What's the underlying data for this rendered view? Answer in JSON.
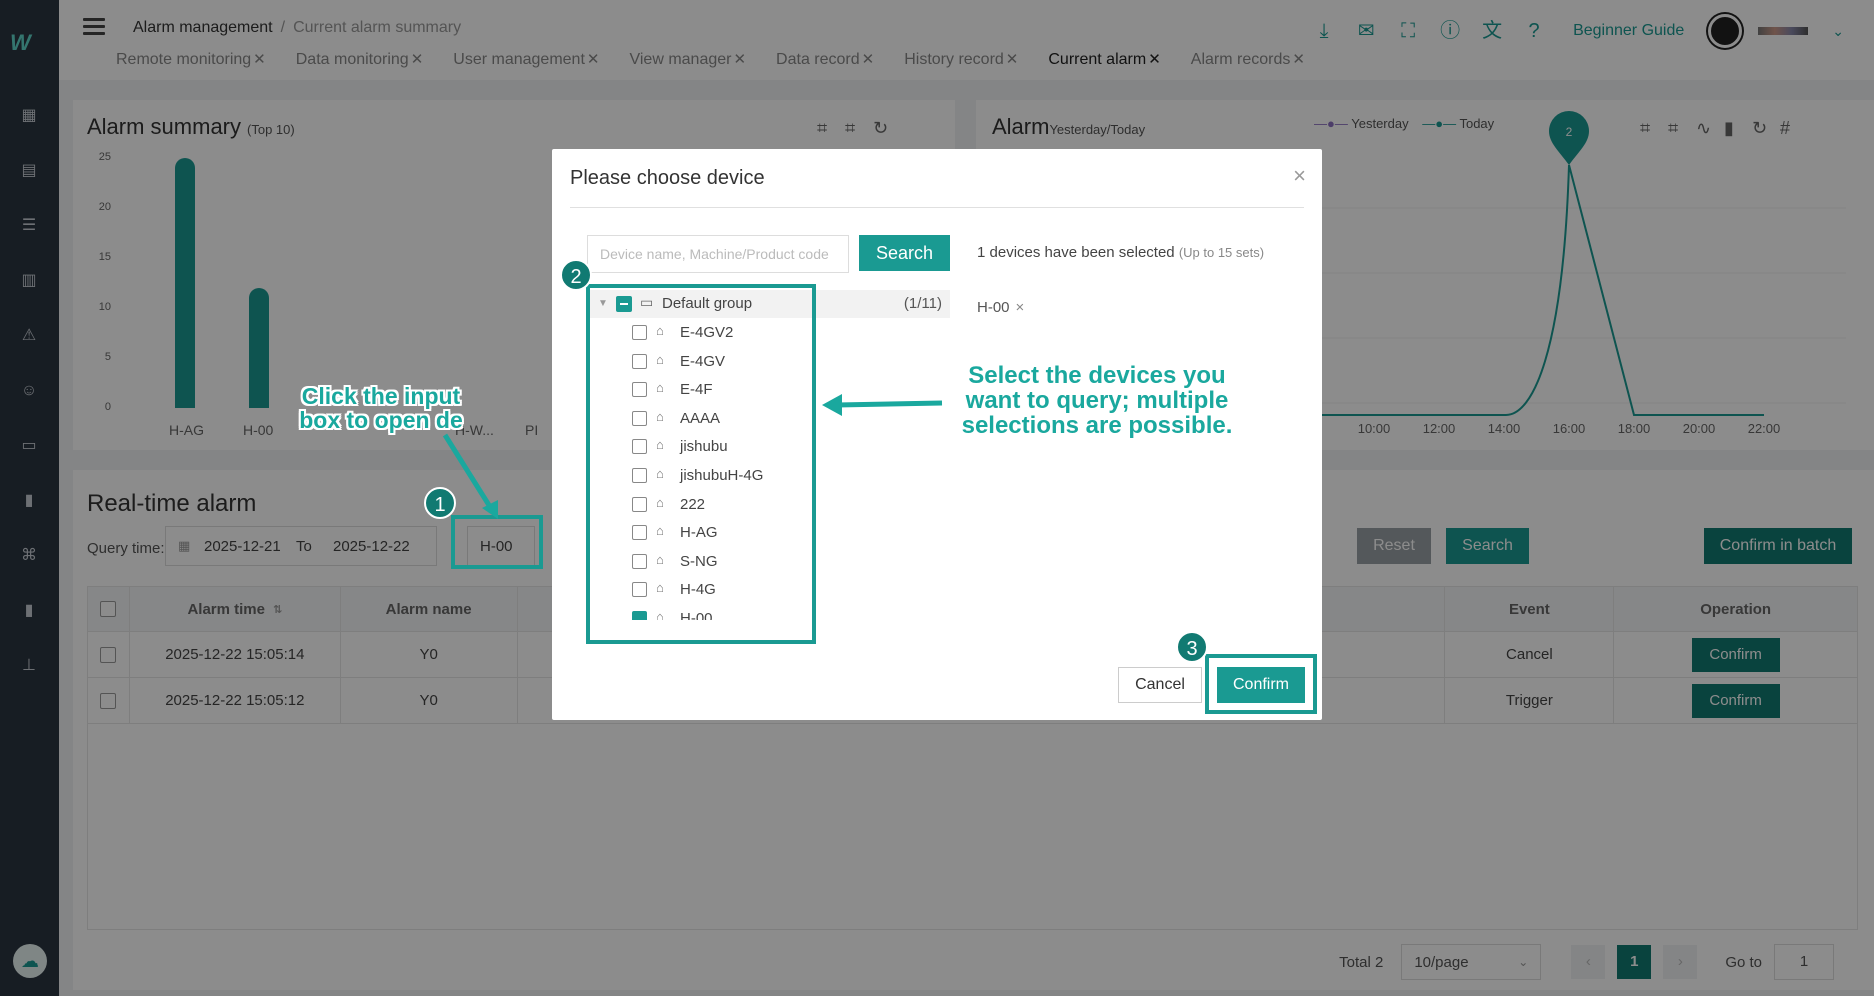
{
  "header": {
    "breadcrumb_root": "Alarm management",
    "breadcrumb_current": "Current alarm summary",
    "beginner_guide": "Beginner Guide",
    "tabs": [
      {
        "label": "Remote monitoring"
      },
      {
        "label": "Data monitoring"
      },
      {
        "label": "User management"
      },
      {
        "label": "View manager"
      },
      {
        "label": "Data record"
      },
      {
        "label": "History record"
      },
      {
        "label": "Current alarm"
      },
      {
        "label": "Alarm records"
      }
    ],
    "tab_close": "✕"
  },
  "alarm_summary": {
    "title": "Alarm summary",
    "subtitle": "(Top 10)"
  },
  "alarm_trend": {
    "title": "Alarm",
    "subtitle": "Yesterday/Today",
    "legend_yesterday": "Yesterday",
    "legend_today": "Today",
    "peak_label": "2"
  },
  "chart_data": [
    {
      "type": "bar",
      "categories": [
        "H-AG",
        "H-00",
        "H-W...",
        "PI"
      ],
      "values": [
        25,
        12,
        0,
        0
      ],
      "ylim": [
        0,
        25
      ],
      "yticks": [
        "25",
        "20",
        "15",
        "10",
        "5",
        "0"
      ]
    },
    {
      "type": "line",
      "x": [
        "10:00",
        "12:00",
        "14:00",
        "16:00",
        "18:00",
        "20:00",
        "22:00"
      ],
      "series": [
        {
          "name": "Yesterday",
          "values": [
            0,
            0,
            0,
            0,
            0,
            0,
            0
          ]
        },
        {
          "name": "Today",
          "values": [
            0,
            0,
            0,
            2,
            0,
            0,
            0
          ]
        }
      ]
    }
  ],
  "realtime": {
    "title": "Real-time alarm",
    "query_label": "Query time:",
    "date_from": "2025-12-21",
    "to_label": "To",
    "date_to": "2025-12-22",
    "device_value": "H-00",
    "reset_label": "Reset",
    "search_label": "Search",
    "confirm_batch_label": "Confirm in batch",
    "columns": {
      "alarm_time": "Alarm time",
      "alarm_name": "Alarm name",
      "event": "Event",
      "operation": "Operation"
    },
    "rows": [
      {
        "time": "2025-12-22 15:05:14",
        "name": "Y0",
        "event": "Cancel",
        "op": "Confirm"
      },
      {
        "time": "2025-12-22 15:05:12",
        "name": "Y0",
        "event": "Trigger",
        "op": "Confirm"
      }
    ]
  },
  "pagination": {
    "total": "Total 2",
    "per_page": "10/page",
    "prev": "‹",
    "current_page": "1",
    "next": "›",
    "goto_label": "Go to",
    "goto_value": "1"
  },
  "modal": {
    "title": "Please choose device",
    "search_placeholder": "Device name, Machine/Product code",
    "search_label": "Search",
    "selected_count": "1 devices have been selected",
    "selected_hint": "(Up to 15 sets)",
    "selected_tag": "H-00",
    "group_label": "Default group",
    "group_count": "(1/11)",
    "devices": [
      {
        "label": "E-4GV2",
        "checked": false
      },
      {
        "label": "E-4GV",
        "checked": false
      },
      {
        "label": "E-4F",
        "checked": false
      },
      {
        "label": "AAAA",
        "checked": false
      },
      {
        "label": "jishubu",
        "checked": false
      },
      {
        "label": "jishubuH-4G",
        "checked": false
      },
      {
        "label": "222",
        "checked": false
      },
      {
        "label": "H-AG",
        "checked": false
      },
      {
        "label": "S-NG",
        "checked": false
      },
      {
        "label": "H-4G",
        "checked": false
      },
      {
        "label": "H-00",
        "checked": true
      }
    ],
    "cancel_label": "Cancel",
    "confirm_label": "Confirm"
  },
  "annotations": {
    "step1": "1",
    "step2": "2",
    "step3": "3",
    "step1_text": "Click the input box to open de",
    "step2_text": "Select the devices you want to query; multiple selections are possible."
  },
  "colors": {
    "accent": "#1a9a92",
    "accent_dark": "#117a72",
    "sidebar": "#2b3540"
  }
}
